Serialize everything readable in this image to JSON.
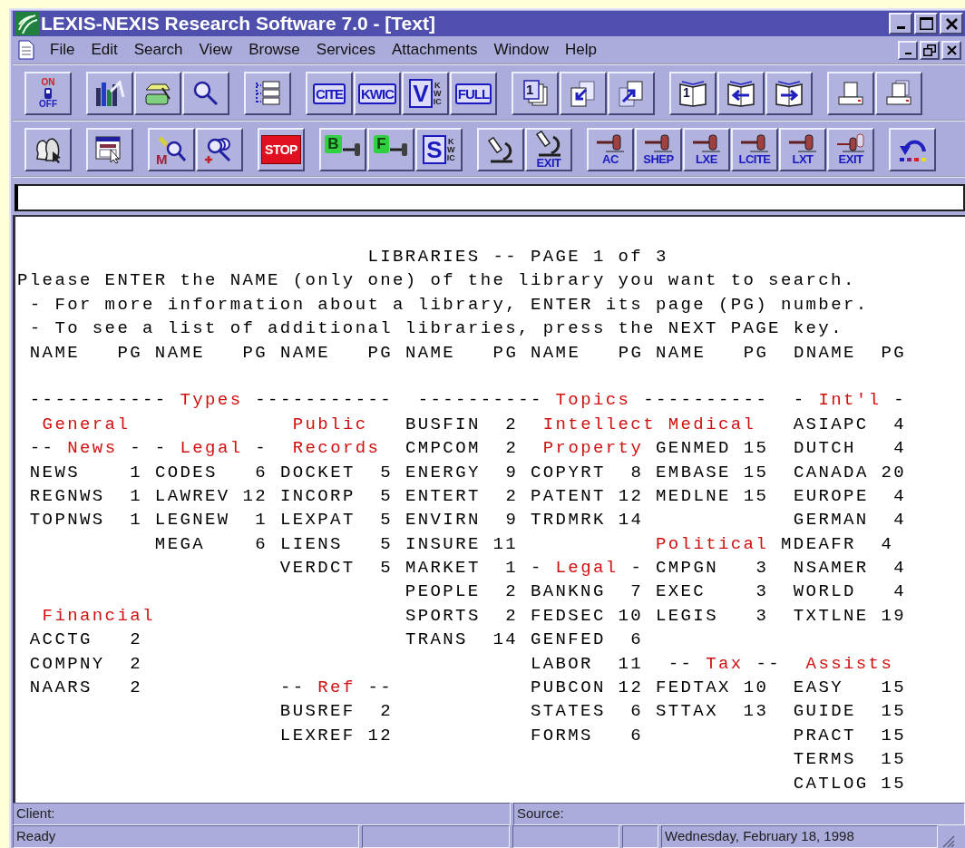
{
  "window": {
    "title": "LEXIS-NEXIS Research Software 7.0 - [Text]"
  },
  "menu": [
    {
      "label": "File"
    },
    {
      "label": "Edit"
    },
    {
      "label": "Search"
    },
    {
      "label": "View"
    },
    {
      "label": "Browse"
    },
    {
      "label": "Services"
    },
    {
      "label": "Attachments"
    },
    {
      "label": "Window"
    },
    {
      "label": "Help"
    }
  ],
  "toolbars": [
    {
      "groups": [
        [
          {
            "kind": "switch",
            "text": [
              "ON",
              "OFF"
            ]
          }
        ],
        [
          {
            "kind": "chart"
          },
          {
            "kind": "folder"
          },
          {
            "kind": "search"
          }
        ],
        [
          {
            "kind": "list"
          }
        ],
        [
          {
            "kind": "label",
            "text": [
              "CITE"
            ]
          },
          {
            "kind": "label",
            "text": [
              "KWIC"
            ]
          },
          {
            "kind": "vlabel",
            "text": [
              "V",
              "KWIC"
            ]
          },
          {
            "kind": "label",
            "text": [
              "FULL"
            ]
          }
        ],
        [
          {
            "kind": "pages",
            "text": [
              "1"
            ]
          },
          {
            "kind": "doc-in"
          },
          {
            "kind": "doc-out"
          }
        ],
        [
          {
            "kind": "book",
            "text": [
              "1"
            ]
          },
          {
            "kind": "book-left"
          },
          {
            "kind": "book-right"
          }
        ],
        [
          {
            "kind": "printer"
          },
          {
            "kind": "printer-stack"
          }
        ]
      ]
    },
    {
      "groups": [
        [
          {
            "kind": "heads"
          }
        ],
        [
          {
            "kind": "window-pointer"
          }
        ],
        [
          {
            "kind": "mark-search",
            "text": [
              "M"
            ]
          },
          {
            "kind": "magnifiers"
          }
        ],
        [
          {
            "kind": "stop",
            "text": [
              "STOP"
            ]
          }
        ],
        [
          {
            "kind": "gavel-letter",
            "text": [
              "B"
            ]
          },
          {
            "kind": "gavel-letter",
            "text": [
              "F"
            ]
          },
          {
            "kind": "vlabel",
            "text": [
              "S",
              "KWIC"
            ]
          }
        ],
        [
          {
            "kind": "microscope"
          },
          {
            "kind": "microscope",
            "text": [
              "EXIT"
            ]
          }
        ],
        [
          {
            "kind": "gavel",
            "text": [
              "AC"
            ]
          },
          {
            "kind": "gavel",
            "text": [
              "SHEP"
            ]
          },
          {
            "kind": "gavel",
            "text": [
              "LXE"
            ]
          },
          {
            "kind": "gavel",
            "text": [
              "LCITE"
            ]
          },
          {
            "kind": "gavel",
            "text": [
              "LXT"
            ]
          },
          {
            "kind": "gavels",
            "text": [
              "EXIT"
            ]
          }
        ],
        [
          {
            "kind": "undo"
          }
        ]
      ]
    }
  ],
  "screen": {
    "lines": [
      {
        "segments": [
          {
            "text": "                            LIBRARIES -- PAGE 1 of 3",
            "kind": "text"
          }
        ]
      },
      {
        "segments": [
          {
            "text": "Please ENTER the NAME (only one) of the library you want to search.",
            "kind": "text"
          }
        ]
      },
      {
        "segments": [
          {
            "text": " - For more information about a library, ENTER its page (PG) number.",
            "kind": "text"
          }
        ]
      },
      {
        "segments": [
          {
            "text": " - To see a list of additional libraries, press the NEXT PAGE key.",
            "kind": "text"
          }
        ]
      },
      {
        "segments": [
          {
            "text": " NAME",
            "kind": "label"
          },
          {
            "text": "   PG",
            "kind": "label"
          },
          {
            "text": " NAME",
            "kind": "label"
          },
          {
            "text": "   PG",
            "kind": "label"
          },
          {
            "text": " NAME",
            "kind": "label"
          },
          {
            "text": "   PG",
            "kind": "label"
          },
          {
            "text": " NAME",
            "kind": "label"
          },
          {
            "text": "   PG",
            "kind": "label"
          },
          {
            "text": " NAME",
            "kind": "label"
          },
          {
            "text": "   PG",
            "kind": "label"
          },
          {
            "text": " NAME",
            "kind": "label"
          },
          {
            "text": "   PG",
            "kind": "label"
          },
          {
            "text": "  DNAME",
            "kind": "label"
          },
          {
            "text": "  PG",
            "kind": "label"
          }
        ]
      },
      {
        "blank_before": true,
        "segments": [
          {
            "text": " -----------",
            "kind": "text"
          },
          {
            "text": " Types",
            "kind": "heading"
          },
          {
            "text": " -----------",
            "kind": "text"
          },
          {
            "text": "  ----------",
            "kind": "text"
          },
          {
            "text": " Topics",
            "kind": "heading"
          },
          {
            "text": " ----------",
            "kind": "text"
          },
          {
            "text": "  -",
            "kind": "text"
          },
          {
            "text": " Int'l",
            "kind": "heading"
          },
          {
            "text": " -",
            "kind": "text"
          }
        ]
      },
      {
        "segments": [
          {
            "text": "  General",
            "kind": "heading"
          },
          {
            "text": "             Public",
            "kind": "heading"
          },
          {
            "text": "   BUSFIN",
            "kind": "name"
          },
          {
            "text": "  2",
            "kind": "page"
          },
          {
            "text": "  Intellect",
            "kind": "heading"
          },
          {
            "text": " Medical",
            "kind": "heading"
          },
          {
            "text": "   ASIAPC",
            "kind": "name"
          },
          {
            "text": "  4",
            "kind": "page"
          }
        ]
      },
      {
        "segments": [
          {
            "text": " --",
            "kind": "text"
          },
          {
            "text": " News",
            "kind": "heading"
          },
          {
            "text": " - -",
            "kind": "text"
          },
          {
            "text": " Legal",
            "kind": "heading"
          },
          {
            "text": " -",
            "kind": "text"
          },
          {
            "text": "  Records",
            "kind": "heading"
          },
          {
            "text": "  CMPCOM",
            "kind": "name"
          },
          {
            "text": "  2",
            "kind": "page"
          },
          {
            "text": "  Property",
            "kind": "heading"
          },
          {
            "text": " GENMED",
            "kind": "name"
          },
          {
            "text": " 15",
            "kind": "page"
          },
          {
            "text": "  DUTCH",
            "kind": "name"
          },
          {
            "text": "   4",
            "kind": "page"
          }
        ]
      },
      {
        "segments": [
          {
            "text": " NEWS",
            "kind": "name"
          },
          {
            "text": "    1",
            "kind": "page"
          },
          {
            "text": " CODES",
            "kind": "name"
          },
          {
            "text": "   6",
            "kind": "page"
          },
          {
            "text": " DOCKET",
            "kind": "name"
          },
          {
            "text": "  5",
            "kind": "page"
          },
          {
            "text": " ENERGY",
            "kind": "name"
          },
          {
            "text": "  9",
            "kind": "page"
          },
          {
            "text": " COPYRT",
            "kind": "name"
          },
          {
            "text": "  8",
            "kind": "page"
          },
          {
            "text": " EMBASE",
            "kind": "name"
          },
          {
            "text": " 15",
            "kind": "page"
          },
          {
            "text": "  CANADA",
            "kind": "name"
          },
          {
            "text": " 20",
            "kind": "page"
          }
        ]
      },
      {
        "segments": [
          {
            "text": " REGNWS",
            "kind": "name"
          },
          {
            "text": "  1",
            "kind": "page"
          },
          {
            "text": " LAWREV",
            "kind": "name"
          },
          {
            "text": " 12",
            "kind": "page"
          },
          {
            "text": " INCORP",
            "kind": "name"
          },
          {
            "text": "  5",
            "kind": "page"
          },
          {
            "text": " ENTERT",
            "kind": "name"
          },
          {
            "text": "  2",
            "kind": "page"
          },
          {
            "text": " PATENT",
            "kind": "name"
          },
          {
            "text": " 12",
            "kind": "page"
          },
          {
            "text": " MEDLNE",
            "kind": "name"
          },
          {
            "text": " 15",
            "kind": "page"
          },
          {
            "text": "  EUROPE",
            "kind": "name"
          },
          {
            "text": "  4",
            "kind": "page"
          }
        ]
      },
      {
        "segments": [
          {
            "text": " TOPNWS",
            "kind": "name"
          },
          {
            "text": "  1",
            "kind": "page"
          },
          {
            "text": " LEGNEW",
            "kind": "name"
          },
          {
            "text": "  1",
            "kind": "page"
          },
          {
            "text": " LEXPAT",
            "kind": "name"
          },
          {
            "text": "  5",
            "kind": "page"
          },
          {
            "text": " ENVIRN",
            "kind": "name"
          },
          {
            "text": "  9",
            "kind": "page"
          },
          {
            "text": " TRDMRK",
            "kind": "name"
          },
          {
            "text": " 14",
            "kind": "page"
          },
          {
            "text": "            GERMAN",
            "kind": "name"
          },
          {
            "text": "  4",
            "kind": "page"
          }
        ]
      },
      {
        "segments": [
          {
            "text": "           MEGA",
            "kind": "name"
          },
          {
            "text": "    6",
            "kind": "page"
          },
          {
            "text": " LIENS",
            "kind": "name"
          },
          {
            "text": "   5",
            "kind": "page"
          },
          {
            "text": " INSURE",
            "kind": "name"
          },
          {
            "text": " 11",
            "kind": "page"
          },
          {
            "text": "           Political",
            "kind": "heading"
          },
          {
            "text": " MDEAFR",
            "kind": "name"
          },
          {
            "text": "  4",
            "kind": "page"
          }
        ]
      },
      {
        "segments": [
          {
            "text": "                     VERDCT",
            "kind": "name"
          },
          {
            "text": "  5",
            "kind": "page"
          },
          {
            "text": " MARKET",
            "kind": "name"
          },
          {
            "text": "  1",
            "kind": "page"
          },
          {
            "text": " -",
            "kind": "text"
          },
          {
            "text": " Legal",
            "kind": "heading"
          },
          {
            "text": " -",
            "kind": "text"
          },
          {
            "text": " CMPGN",
            "kind": "name"
          },
          {
            "text": "   3",
            "kind": "page"
          },
          {
            "text": "  NSAMER",
            "kind": "name"
          },
          {
            "text": "  4",
            "kind": "page"
          }
        ]
      },
      {
        "segments": [
          {
            "text": "                               PEOPLE",
            "kind": "name"
          },
          {
            "text": "  2",
            "kind": "page"
          },
          {
            "text": " BANKNG",
            "kind": "name"
          },
          {
            "text": "  7",
            "kind": "page"
          },
          {
            "text": " EXEC",
            "kind": "name"
          },
          {
            "text": "    3",
            "kind": "page"
          },
          {
            "text": "  WORLD",
            "kind": "name"
          },
          {
            "text": "   4",
            "kind": "page"
          }
        ]
      },
      {
        "segments": [
          {
            "text": "  Financial",
            "kind": "heading"
          },
          {
            "text": "                    SPORTS",
            "kind": "name"
          },
          {
            "text": "  2",
            "kind": "page"
          },
          {
            "text": " FEDSEC",
            "kind": "name"
          },
          {
            "text": " 10",
            "kind": "page"
          },
          {
            "text": " LEGIS",
            "kind": "name"
          },
          {
            "text": "   3",
            "kind": "page"
          },
          {
            "text": "  TXTLNE",
            "kind": "name"
          },
          {
            "text": " 19",
            "kind": "page"
          }
        ]
      },
      {
        "segments": [
          {
            "text": " ACCTG",
            "kind": "name"
          },
          {
            "text": "   2",
            "kind": "page"
          },
          {
            "text": "                     TRANS",
            "kind": "name"
          },
          {
            "text": "  14",
            "kind": "page"
          },
          {
            "text": " GENFED",
            "kind": "name"
          },
          {
            "text": "  6",
            "kind": "page"
          }
        ]
      },
      {
        "segments": [
          {
            "text": " COMPNY",
            "kind": "name"
          },
          {
            "text": "  2",
            "kind": "page"
          },
          {
            "text": "                               LABOR",
            "kind": "name"
          },
          {
            "text": "  11",
            "kind": "page"
          },
          {
            "text": "  --",
            "kind": "text"
          },
          {
            "text": " Tax",
            "kind": "heading"
          },
          {
            "text": " --",
            "kind": "text"
          },
          {
            "text": "  Assists",
            "kind": "heading"
          }
        ]
      },
      {
        "segments": [
          {
            "text": " NAARS",
            "kind": "name"
          },
          {
            "text": "   2",
            "kind": "page"
          },
          {
            "text": "           --",
            "kind": "text"
          },
          {
            "text": " Ref",
            "kind": "heading"
          },
          {
            "text": " --",
            "kind": "text"
          },
          {
            "text": "           PUBCON",
            "kind": "name"
          },
          {
            "text": " 12",
            "kind": "page"
          },
          {
            "text": " FEDTAX",
            "kind": "name"
          },
          {
            "text": " 10",
            "kind": "page"
          },
          {
            "text": "  EASY",
            "kind": "name"
          },
          {
            "text": "   15",
            "kind": "page"
          }
        ]
      },
      {
        "segments": [
          {
            "text": "                     BUSREF",
            "kind": "name"
          },
          {
            "text": "  2",
            "kind": "page"
          },
          {
            "text": "           STATES",
            "kind": "name"
          },
          {
            "text": "  6",
            "kind": "page"
          },
          {
            "text": " STTAX",
            "kind": "name"
          },
          {
            "text": "  13",
            "kind": "page"
          },
          {
            "text": "  GUIDE",
            "kind": "name"
          },
          {
            "text": "  15",
            "kind": "page"
          }
        ]
      },
      {
        "segments": [
          {
            "text": "                     LEXREF",
            "kind": "name"
          },
          {
            "text": " 12",
            "kind": "page"
          },
          {
            "text": "           FORMS",
            "kind": "name"
          },
          {
            "text": "   6",
            "kind": "page"
          },
          {
            "text": "            PRACT",
            "kind": "name"
          },
          {
            "text": "  15",
            "kind": "page"
          }
        ]
      },
      {
        "segments": [
          {
            "text": "                                                              TERMS",
            "kind": "name"
          },
          {
            "text": "  15",
            "kind": "page"
          }
        ]
      },
      {
        "segments": [
          {
            "text": "                                                              CATLOG",
            "kind": "name"
          },
          {
            "text": " 15",
            "kind": "page"
          }
        ]
      }
    ]
  },
  "status_bar": {
    "client": "Client:",
    "source": "Source:",
    "message": "Ready",
    "date": "Wednesday, February 18, 1998"
  }
}
